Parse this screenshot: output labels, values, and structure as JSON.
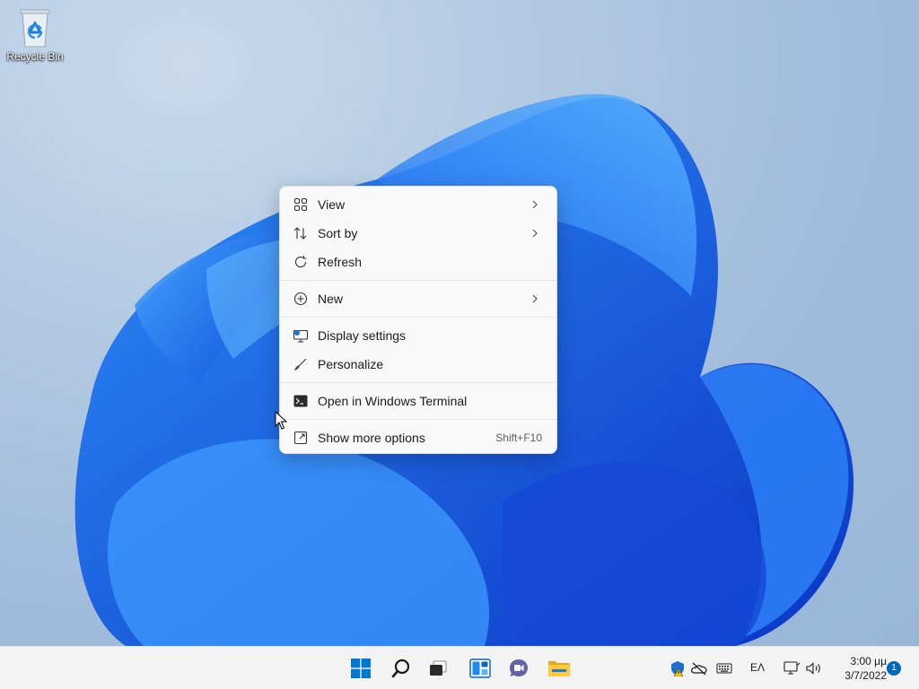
{
  "desktop": {
    "icons": [
      {
        "label": "Recycle Bin",
        "icon": "recycle-bin-icon"
      }
    ]
  },
  "context_menu": {
    "items": [
      {
        "label": "View",
        "icon": "grid-icon",
        "submenu": true
      },
      {
        "label": "Sort by",
        "icon": "sort-arrows-icon",
        "submenu": true
      },
      {
        "label": "Refresh",
        "icon": "refresh-icon",
        "submenu": false
      },
      {
        "label": "New",
        "icon": "plus-circle-icon",
        "submenu": true
      },
      {
        "label": "Display settings",
        "icon": "display-settings-icon",
        "submenu": false
      },
      {
        "label": "Personalize",
        "icon": "brush-icon",
        "submenu": false
      },
      {
        "label": "Open in Windows Terminal",
        "icon": "terminal-icon",
        "submenu": false
      },
      {
        "label": "Show more options",
        "icon": "more-options-icon",
        "shortcut": "Shift+F10"
      }
    ]
  },
  "taskbar": {
    "apps": [
      {
        "name": "Start",
        "icon": "windows-logo-icon"
      },
      {
        "name": "Search",
        "icon": "search-icon"
      },
      {
        "name": "Task View",
        "icon": "task-view-icon"
      },
      {
        "name": "Widgets",
        "icon": "widgets-icon"
      },
      {
        "name": "Chat",
        "icon": "chat-icon"
      },
      {
        "name": "File Explorer",
        "icon": "file-explorer-icon"
      }
    ],
    "tray": {
      "language": "ΕΛ",
      "time": "3:00 μμ",
      "date": "3/7/2022",
      "notification_count": "1"
    }
  },
  "colors": {
    "accent": "#0067c0",
    "menu_bg": "#f9f9f9",
    "taskbar_bg": "#f3f3f3"
  }
}
